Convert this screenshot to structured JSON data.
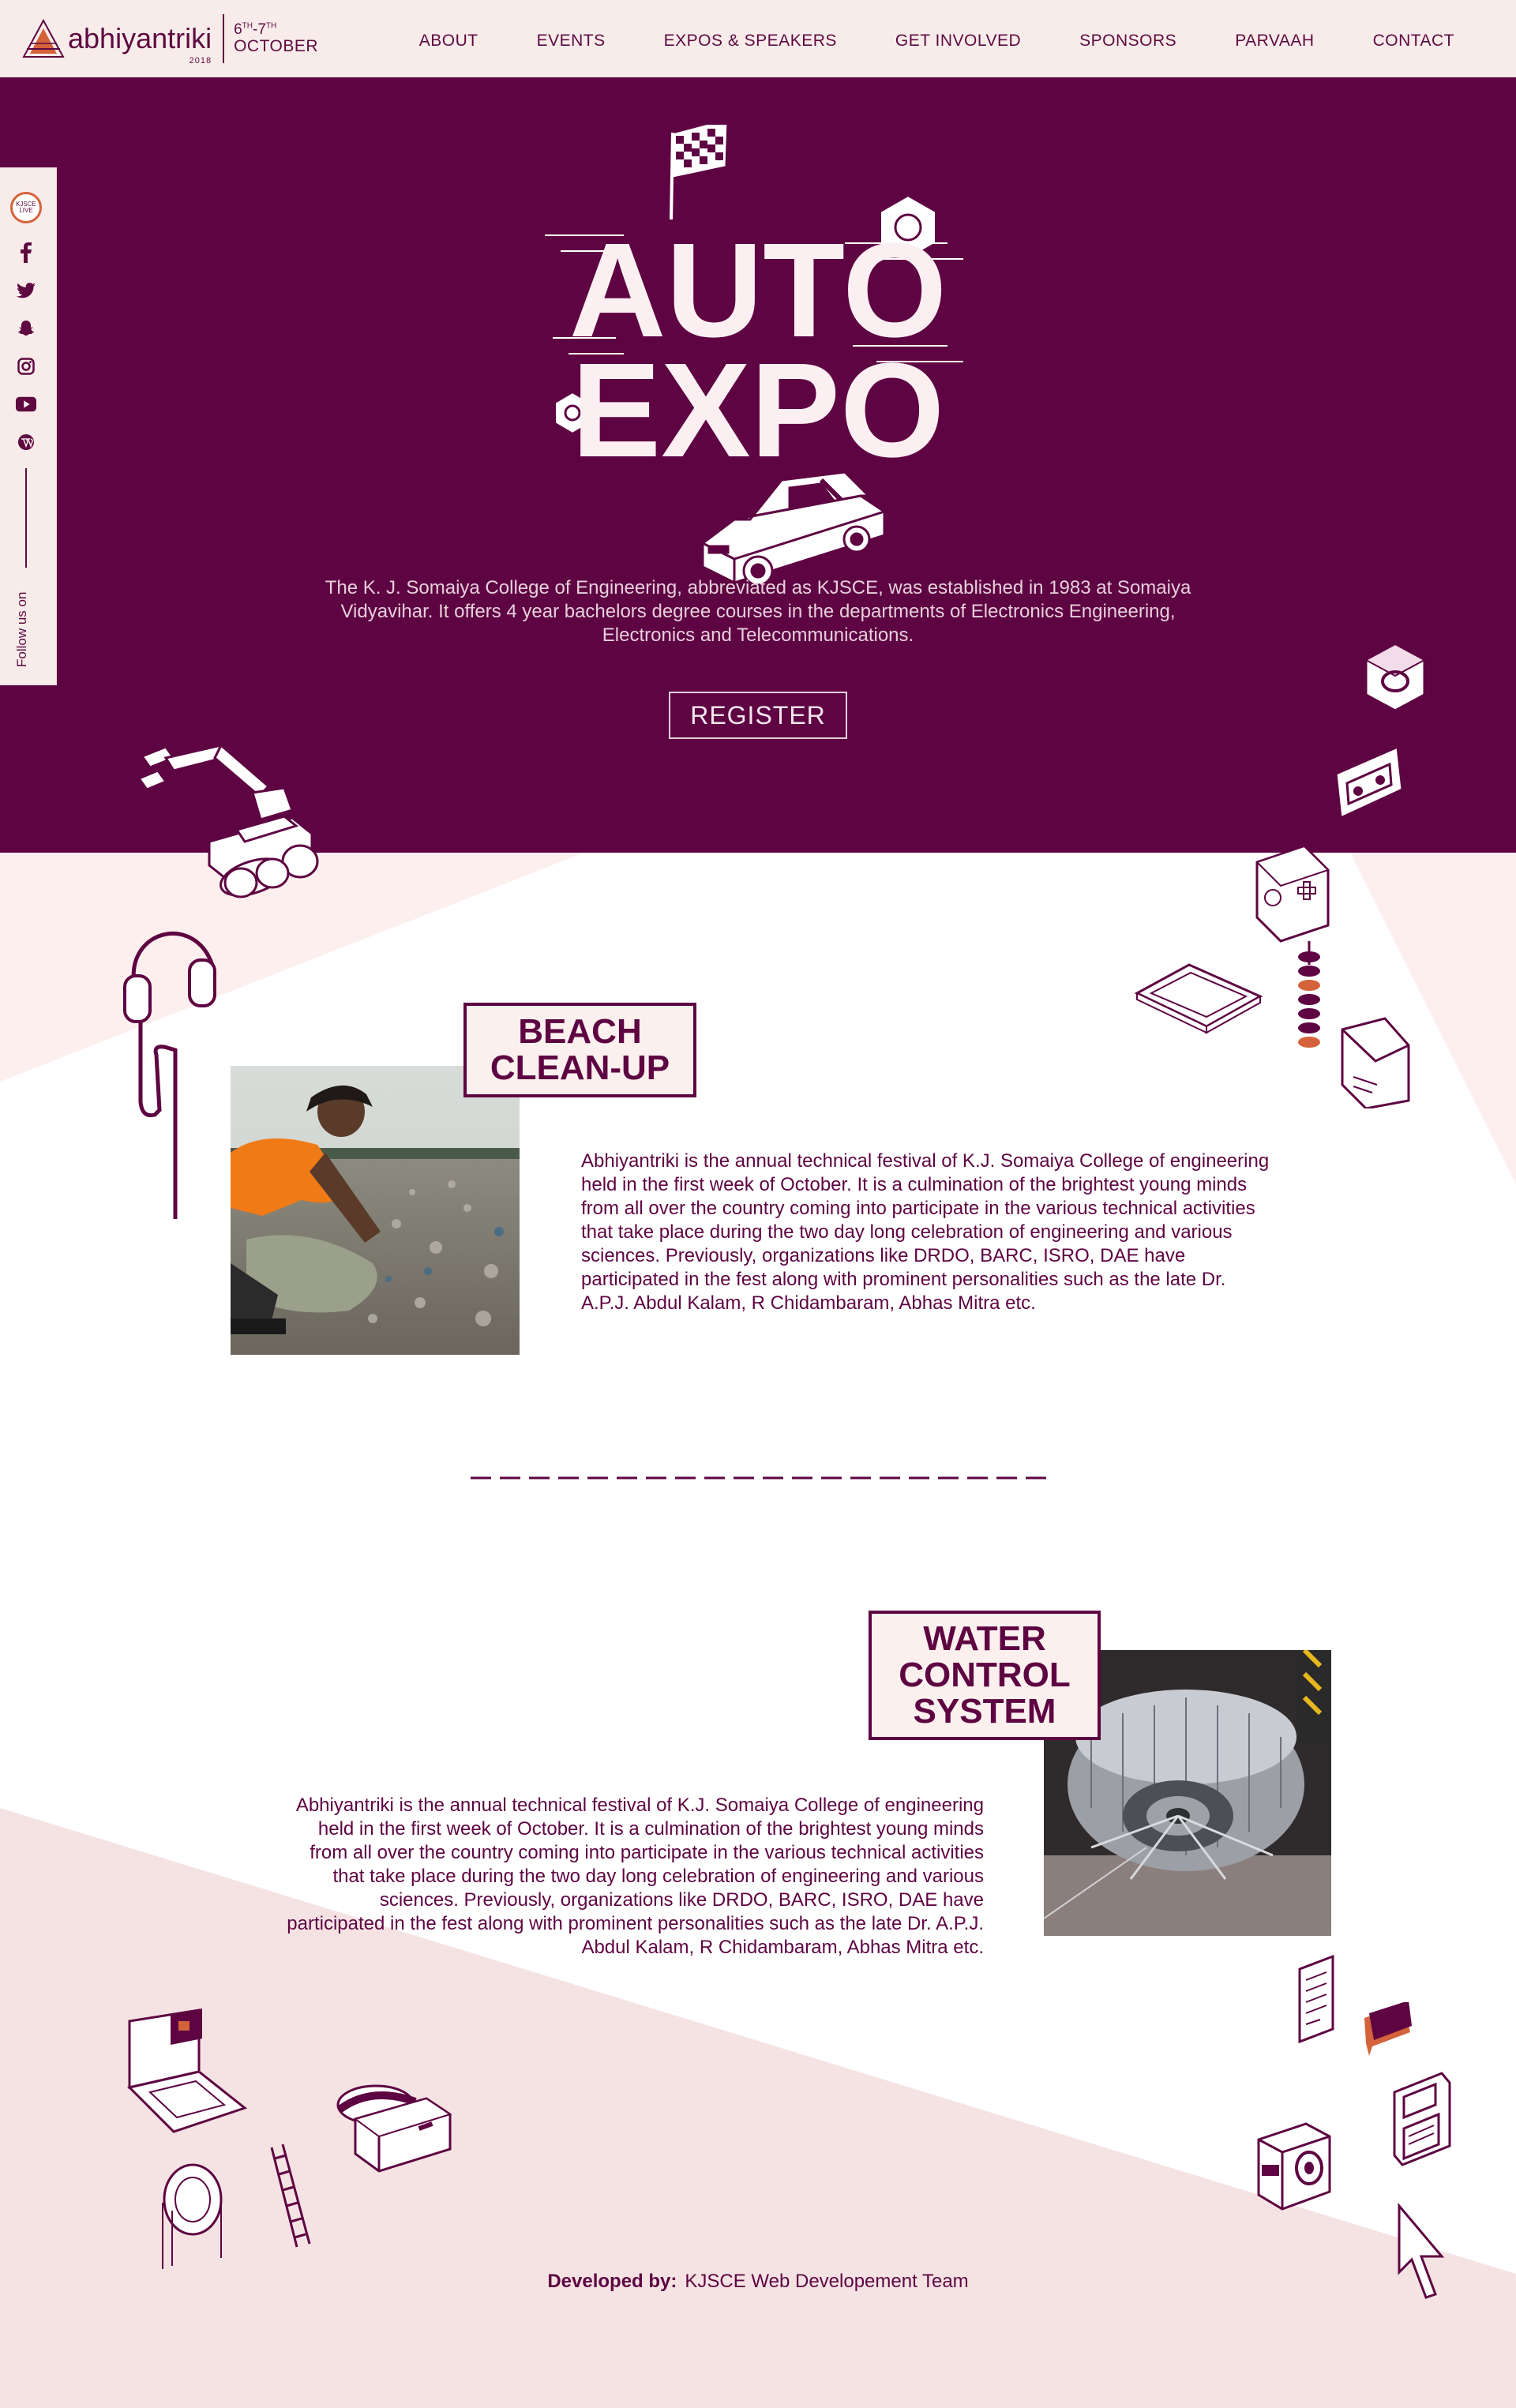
{
  "brand": {
    "name": "abhiyantriki",
    "year": "2018",
    "day_start": "6",
    "day_end": "7",
    "ordinal": "TH",
    "month": "OCTOBER"
  },
  "nav": [
    {
      "label": "ABOUT"
    },
    {
      "label": "EVENTS"
    },
    {
      "label": "EXPOS & SPEAKERS"
    },
    {
      "label": "GET INVOLVED"
    },
    {
      "label": "SPONSORS"
    },
    {
      "label": "PARVAAH"
    },
    {
      "label": "CONTACT"
    }
  ],
  "social": {
    "badge": "KJSCE LIVE",
    "follow_label": "Follow us on",
    "icons": [
      "facebook-icon",
      "twitter-icon",
      "snapchat-icon",
      "instagram-icon",
      "youtube-icon",
      "wordpress-icon"
    ]
  },
  "hero": {
    "title_line1": "AUTO",
    "title_line2": "EXPO",
    "description": "The K. J. Somaiya College of Engineering, abbreviated as KJSCE, was established in 1983 at Somaiya Vidyavihar. It offers 4 year bachelors degree courses in the departments of Electronics Engineering, Electronics and Telecommunications.",
    "register_label": "REGISTER"
  },
  "events": [
    {
      "title_lines": [
        "BEACH",
        "CLEAN-UP"
      ],
      "description": "Abhiyantriki is the annual technical festival of K.J. Somaiya College of engineering held in the first week of October. It is a culmination of the brightest young minds from all over the country coming into participate in the various technical activities that take place during the two day long celebration of engineering and various sciences. Previously, organizations like DRDO, BARC, ISRO, DAE have participated in the fest along with prominent personalities such as the late Dr. A.P.J. Abdul Kalam, R Chidambaram, Abhas Mitra etc."
    },
    {
      "title_lines": [
        "WATER",
        "CONTROL",
        "SYSTEM"
      ],
      "description": "Abhiyantriki is the annual technical festival of K.J. Somaiya College of engineering held in the first week of October. It is a culmination of the brightest young minds from all over the country coming into participate in the various technical activities that take place during the two day long celebration of engineering and various sciences. Previously, organizations like DRDO, BARC, ISRO, DAE have participated in the fest along with prominent personalities such as the late Dr. A.P.J. Abdul Kalam, R Chidambaram, Abhas Mitra etc."
    }
  ],
  "footer": {
    "developed_label": "Developed by:",
    "team": "KJSCE Web Developement Team"
  },
  "colors": {
    "primary": "#5e0442",
    "header_bg": "#f8ecea",
    "light_pink": "#fcefee",
    "mid_pink": "#f5e3e3",
    "accent_orange": "#d4623a"
  }
}
